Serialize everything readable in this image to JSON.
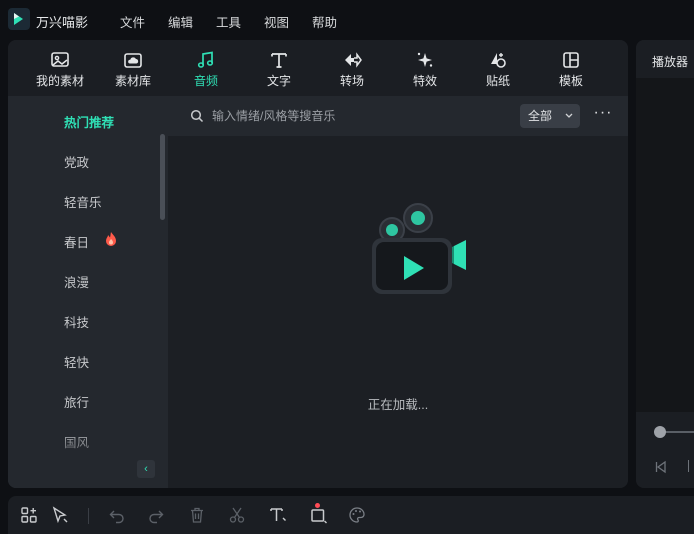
{
  "app": {
    "name": "万兴喵影"
  },
  "menu": [
    "文件",
    "编辑",
    "工具",
    "视图",
    "帮助"
  ],
  "tabs": [
    {
      "label": "我的素材",
      "icon": "image-icon"
    },
    {
      "label": "素材库",
      "icon": "cloud-folder-icon"
    },
    {
      "label": "音频",
      "icon": "music-note-icon",
      "active": true
    },
    {
      "label": "文字",
      "icon": "text-icon"
    },
    {
      "label": "转场",
      "icon": "transition-icon"
    },
    {
      "label": "特效",
      "icon": "sparkle-icon"
    },
    {
      "label": "贴纸",
      "icon": "sticker-icon"
    },
    {
      "label": "模板",
      "icon": "template-icon"
    }
  ],
  "sidebar": {
    "items": [
      {
        "label": "热门推荐",
        "active": true
      },
      {
        "label": "党政"
      },
      {
        "label": "轻音乐"
      },
      {
        "label": "春日",
        "badge": "fire-icon"
      },
      {
        "label": "浪漫"
      },
      {
        "label": "科技"
      },
      {
        "label": "轻快"
      },
      {
        "label": "旅行"
      },
      {
        "label": "国风"
      }
    ],
    "collapse": "‹"
  },
  "search": {
    "placeholder": "输入情绪/风格等搜音乐"
  },
  "filter": {
    "selected": "全部"
  },
  "more": "···",
  "status": {
    "loading": "正在加载..."
  },
  "player": {
    "title": "播放器"
  },
  "colors": {
    "accent": "#2fe0b5",
    "notification": "#ff4b55",
    "fire": "#ff5a4a"
  },
  "toolbar": [
    "layout-icon",
    "select-arrow-icon",
    "undo-icon",
    "redo-icon",
    "delete-icon",
    "cut-icon",
    "text-add-icon",
    "crop-icon",
    "color-palette-icon"
  ]
}
